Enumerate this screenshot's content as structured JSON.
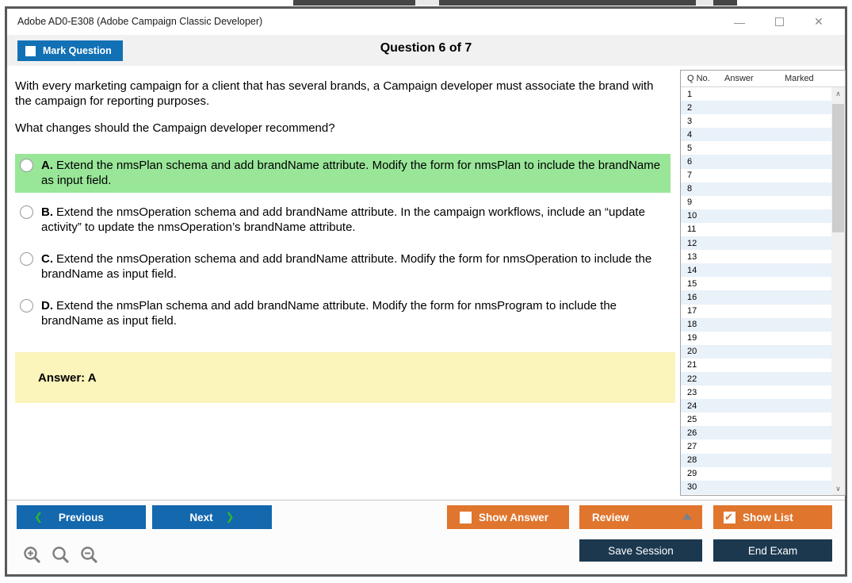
{
  "window": {
    "title": "Adobe AD0-E308 (Adobe Campaign Classic Developer)",
    "controls": {
      "minimize": "—",
      "close": "✕"
    }
  },
  "toolbar": {
    "mark_question_label": "Mark Question",
    "question_counter": "Question 6 of 7"
  },
  "question": {
    "paragraphs": [
      "With every marketing campaign for a client that has several brands, a Campaign developer must associate the brand with the campaign for reporting purposes.",
      "What changes should the Campaign developer recommend?"
    ],
    "options": [
      {
        "letter": "A.",
        "text": "Extend the nmsPlan schema and add brandName attribute. Modify the form for nmsPlan to include the brandName as input field.",
        "highlighted": true
      },
      {
        "letter": "B.",
        "text": "Extend the nmsOperation schema and add brandName attribute. In the campaign workflows, include an “update activity” to update the nmsOperation’s brandName attribute.",
        "highlighted": false
      },
      {
        "letter": "C.",
        "text": "Extend the nmsOperation schema and add brandName attribute. Modify the form for nmsOperation to include the brandName as input field.",
        "highlighted": false
      },
      {
        "letter": "D.",
        "text": "Extend the nmsPlan schema and add brandName attribute. Modify the form for nmsProgram to include the brandName as input field.",
        "highlighted": false
      }
    ],
    "answer_label": "Answer: A"
  },
  "question_list": {
    "headers": {
      "no": "Q No.",
      "answer": "Answer",
      "marked": "Marked"
    },
    "rows": [
      "1",
      "2",
      "3",
      "4",
      "5",
      "6",
      "7",
      "8",
      "9",
      "10",
      "11",
      "12",
      "13",
      "14",
      "15",
      "16",
      "17",
      "18",
      "19",
      "20",
      "21",
      "22",
      "23",
      "24",
      "25",
      "26",
      "27",
      "28",
      "29",
      "30"
    ]
  },
  "footer": {
    "previous_label": "Previous",
    "next_label": "Next",
    "show_answer_label": "Show Answer",
    "review_label": "Review",
    "show_list_label": "Show List",
    "save_session_label": "Save Session",
    "end_exam_label": "End Exam"
  },
  "colors": {
    "accent_blue": "#1368ae",
    "accent_orange": "#e0752d",
    "navy": "#1c384f",
    "highlight_green": "#99e699",
    "answer_yellow": "#fbf4bb",
    "alt_row_blue": "#e9f1f9"
  }
}
